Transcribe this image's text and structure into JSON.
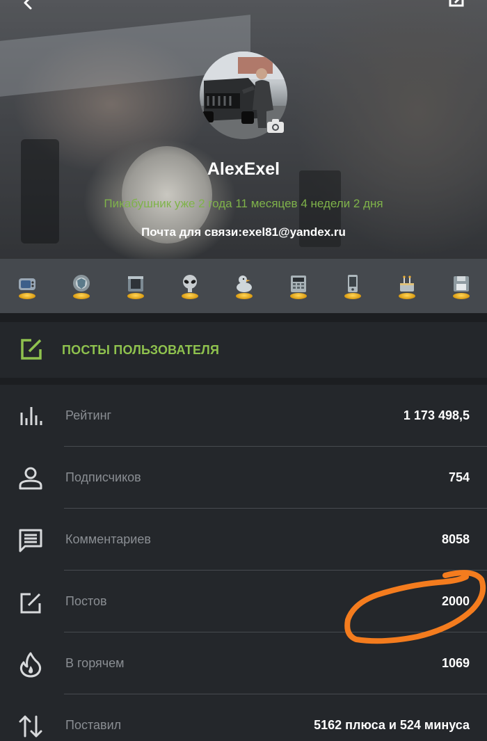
{
  "header": {
    "back_icon": "chevron-left-icon",
    "edit_icon": "edit-icon",
    "username": "AlexExel",
    "tenure": "Пикабушник уже 2 года 11 месяцев 4 недели 2 дня",
    "contact": "Почта для связи:exel81@yandex.ru",
    "accent_color": "#7fb34a"
  },
  "awards": [
    {
      "icon": "tv-award-icon"
    },
    {
      "icon": "shield-award-icon"
    },
    {
      "icon": "frame-award-icon"
    },
    {
      "icon": "alien-award-icon"
    },
    {
      "icon": "duck-award-icon"
    },
    {
      "icon": "calculator-award-icon"
    },
    {
      "icon": "tablet-award-icon"
    },
    {
      "icon": "cake-award-icon"
    },
    {
      "icon": "floppy-award-icon"
    }
  ],
  "posts_section": {
    "label": "ПОСТЫ ПОЛЬЗОВАТЕЛЯ",
    "icon": "edit-icon",
    "color": "#8fc24e"
  },
  "stats": [
    {
      "icon": "rating-bars-icon",
      "label": "Рейтинг",
      "value": "1 173 498,5"
    },
    {
      "icon": "person-icon",
      "label": "Подписчиков",
      "value": "754"
    },
    {
      "icon": "comment-icon",
      "label": "Комментариев",
      "value": "8058"
    },
    {
      "icon": "edit-icon",
      "label": "Постов",
      "value": "2000"
    },
    {
      "icon": "flame-icon",
      "label": "В горячем",
      "value": "1069"
    },
    {
      "icon": "up-down-arrows-icon",
      "label": "Поставил",
      "value": "5162 плюса и 524 минуса"
    }
  ],
  "annotation": {
    "color": "#f47c1e",
    "target": "Постов"
  }
}
